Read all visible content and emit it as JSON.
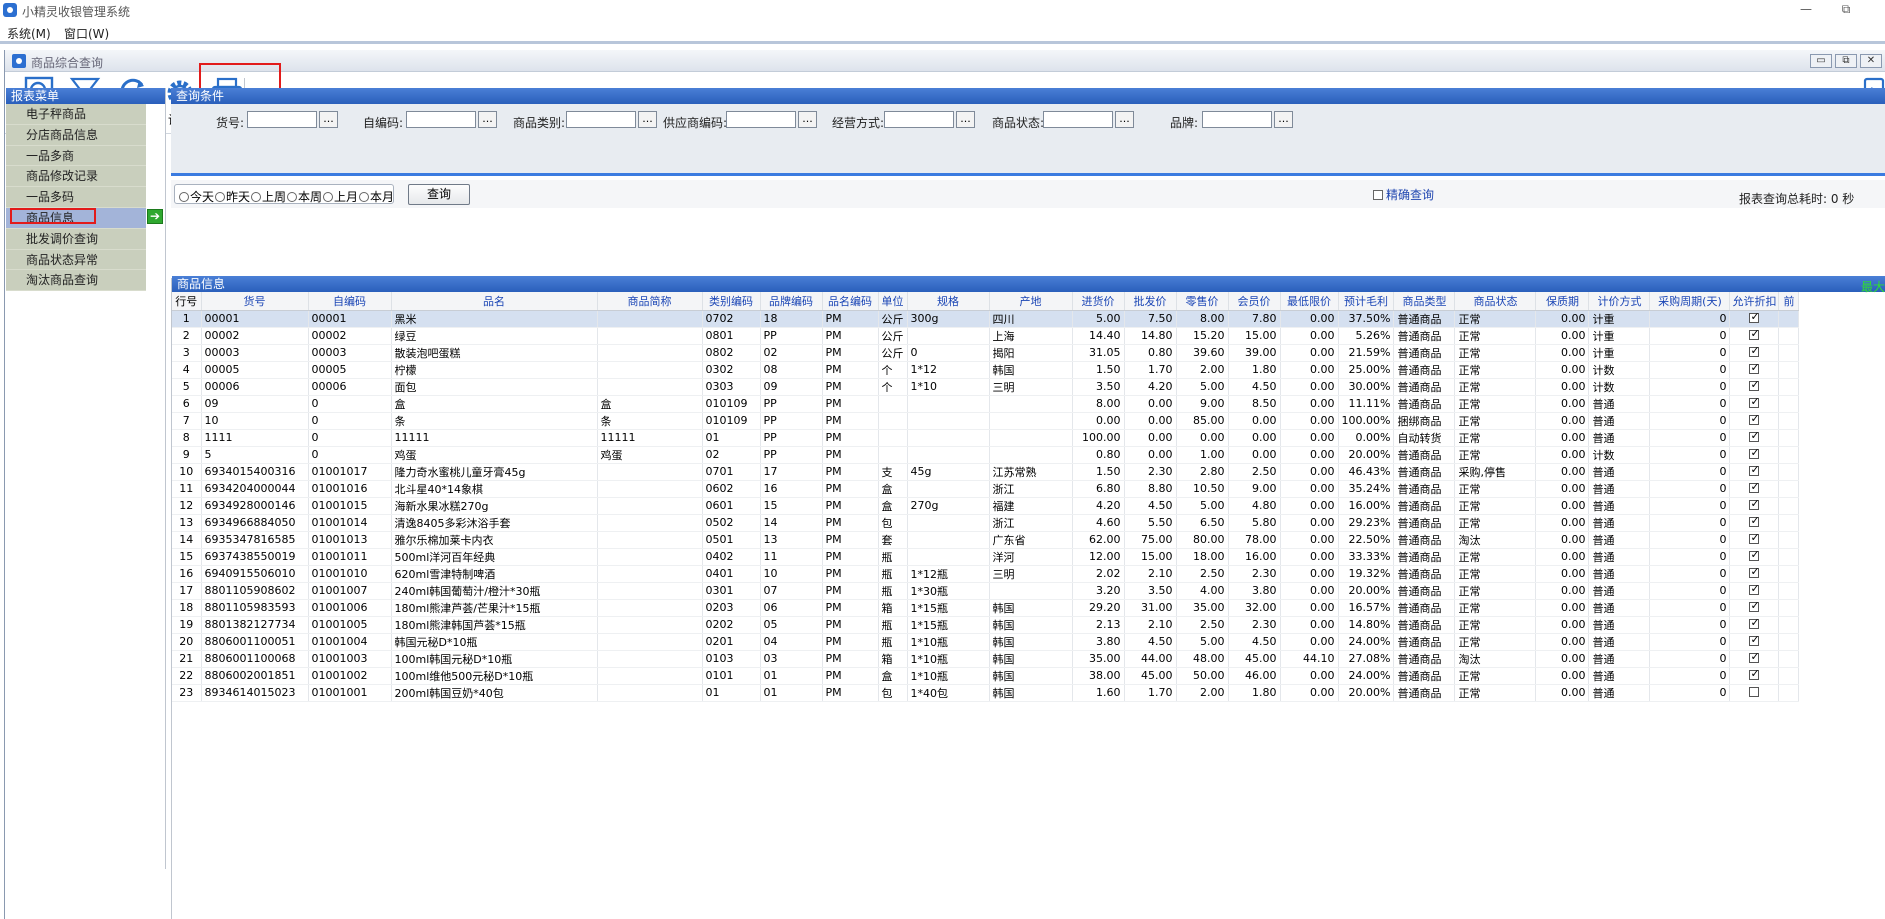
{
  "app": {
    "title": "小精灵收银管理系统",
    "min": "—",
    "restore": "⧉"
  },
  "menubar": {
    "system": "系统(M)",
    "window": "窗口(W)"
  },
  "child": {
    "title": "商品综合查询",
    "min": "▭",
    "restore": "⧉",
    "close": "✕"
  },
  "toolbar": {
    "query": "查询",
    "filter": "过滤",
    "sort": "排序",
    "settings": "设置",
    "print": "打印",
    "exit": "退出"
  },
  "left": {
    "header": "报表菜单",
    "items": [
      "电子秤商品",
      "分店商品信息",
      "一品多商",
      "商品修改记录",
      "一品多码",
      "商品信息",
      "批发调价查询",
      "商品状态异常",
      "淘汰商品查询"
    ],
    "selected_index": 5
  },
  "query": {
    "header": "查询条件",
    "labels": [
      "货号:",
      "自编码:",
      "商品类别:",
      "供应商编码:",
      "经营方式:",
      "商品状态:",
      "品牌:"
    ],
    "dots": "..."
  },
  "dates": {
    "options": [
      "今天",
      "昨天",
      "上周",
      "本周",
      "上月",
      "本月"
    ],
    "query_button": "查询",
    "exact": "精确查询",
    "elapsed": "报表查询总耗时: 0 秒"
  },
  "grid": {
    "header": "商品信息",
    "max_label": "最大",
    "columns": [
      "行号",
      "货号",
      "自编码",
      "品名",
      "商品简称",
      "类别编码",
      "品牌编码",
      "品名编码",
      "单位",
      "规格",
      "产地",
      "进货价",
      "批发价",
      "零售价",
      "会员价",
      "最低限价",
      "预计毛利",
      "商品类型",
      "商品状态",
      "保质期",
      "计价方式",
      "采购周期(天)",
      "允许折扣",
      "前"
    ],
    "rows": [
      [
        "1",
        "00001",
        "00001",
        "黑米",
        "",
        "0702",
        "18",
        "PM",
        "公斤",
        "300g",
        "四川",
        "5.00",
        "7.50",
        "8.00",
        "7.80",
        "0.00",
        "37.50%",
        "普通商品",
        "正常",
        "0.00",
        "计重",
        "0",
        true
      ],
      [
        "2",
        "00002",
        "00002",
        "绿豆",
        "",
        "0801",
        "PP",
        "PM",
        "公斤",
        "",
        "上海",
        "14.40",
        "14.80",
        "15.20",
        "15.00",
        "0.00",
        "5.26%",
        "普通商品",
        "正常",
        "0.00",
        "计重",
        "0",
        true
      ],
      [
        "3",
        "00003",
        "00003",
        "散装泡吧蛋糕",
        "",
        "0802",
        "02",
        "PM",
        "公斤",
        "0",
        "揭阳",
        "31.05",
        "0.80",
        "39.60",
        "39.00",
        "0.00",
        "21.59%",
        "普通商品",
        "正常",
        "0.00",
        "计重",
        "0",
        true
      ],
      [
        "4",
        "00005",
        "00005",
        "柠檬",
        "",
        "0302",
        "08",
        "PM",
        "个",
        "1*12",
        "韩国",
        "1.50",
        "1.70",
        "2.00",
        "1.80",
        "0.00",
        "25.00%",
        "普通商品",
        "正常",
        "0.00",
        "计数",
        "0",
        true
      ],
      [
        "5",
        "00006",
        "00006",
        "面包",
        "",
        "0303",
        "09",
        "PM",
        "个",
        "1*10",
        "三明",
        "3.50",
        "4.20",
        "5.00",
        "4.50",
        "0.00",
        "30.00%",
        "普通商品",
        "正常",
        "0.00",
        "计数",
        "0",
        true
      ],
      [
        "6",
        "09",
        "0",
        "盒",
        "盒",
        "010109",
        "PP",
        "PM",
        "",
        "",
        "",
        "8.00",
        "0.00",
        "9.00",
        "8.50",
        "0.00",
        "11.11%",
        "普通商品",
        "正常",
        "0.00",
        "普通",
        "0",
        true
      ],
      [
        "7",
        "10",
        "0",
        "条",
        "条",
        "010109",
        "PP",
        "PM",
        "",
        "",
        "",
        "0.00",
        "0.00",
        "85.00",
        "0.00",
        "0.00",
        "100.00%",
        "捆绑商品",
        "正常",
        "0.00",
        "普通",
        "0",
        true
      ],
      [
        "8",
        "1111",
        "0",
        "11111",
        "11111",
        "01",
        "PP",
        "PM",
        "",
        "",
        "",
        "100.00",
        "0.00",
        "0.00",
        "0.00",
        "0.00",
        "0.00%",
        "自动转货",
        "正常",
        "0.00",
        "普通",
        "0",
        true
      ],
      [
        "9",
        "5",
        "0",
        "鸡蛋",
        "鸡蛋",
        "02",
        "PP",
        "PM",
        "",
        "",
        "",
        "0.80",
        "0.00",
        "1.00",
        "0.00",
        "0.00",
        "20.00%",
        "普通商品",
        "正常",
        "0.00",
        "计数",
        "0",
        true
      ],
      [
        "10",
        "6934015400316",
        "01001017",
        "隆力奇水蜜桃儿童牙膏45g",
        "",
        "0701",
        "17",
        "PM",
        "支",
        "45g",
        "江苏常熟",
        "1.50",
        "2.30",
        "2.80",
        "2.50",
        "0.00",
        "46.43%",
        "普通商品",
        "采购,停售",
        "0.00",
        "普通",
        "0",
        true
      ],
      [
        "11",
        "6934204000044",
        "01001016",
        "北斗星40*14象棋",
        "",
        "0602",
        "16",
        "PM",
        "盒",
        "",
        "浙江",
        "6.80",
        "8.80",
        "10.50",
        "9.00",
        "0.00",
        "35.24%",
        "普通商品",
        "正常",
        "0.00",
        "普通",
        "0",
        true
      ],
      [
        "12",
        "6934928000146",
        "01001015",
        "海新水果冰糕270g",
        "",
        "0601",
        "15",
        "PM",
        "盒",
        "270g",
        "福建",
        "4.20",
        "4.50",
        "5.00",
        "4.80",
        "0.00",
        "16.00%",
        "普通商品",
        "正常",
        "0.00",
        "普通",
        "0",
        true
      ],
      [
        "13",
        "6934966884050",
        "01001014",
        "清逸8405多彩沐浴手套",
        "",
        "0502",
        "14",
        "PM",
        "包",
        "",
        "浙江",
        "4.60",
        "5.50",
        "6.50",
        "5.80",
        "0.00",
        "29.23%",
        "普通商品",
        "正常",
        "0.00",
        "普通",
        "0",
        true
      ],
      [
        "14",
        "6935347816585",
        "01001013",
        "雅尔乐棉加莱卡内衣",
        "",
        "0501",
        "13",
        "PM",
        "套",
        "",
        "广东省",
        "62.00",
        "75.00",
        "80.00",
        "78.00",
        "0.00",
        "22.50%",
        "普通商品",
        "淘汰",
        "0.00",
        "普通",
        "0",
        true
      ],
      [
        "15",
        "6937438550019",
        "01001011",
        "500ml洋河百年经典",
        "",
        "0402",
        "11",
        "PM",
        "瓶",
        "",
        "洋河",
        "12.00",
        "15.00",
        "18.00",
        "16.00",
        "0.00",
        "33.33%",
        "普通商品",
        "正常",
        "0.00",
        "普通",
        "0",
        true
      ],
      [
        "16",
        "6940915506010",
        "01001010",
        "620ml雪津特制啤酒",
        "",
        "0401",
        "10",
        "PM",
        "瓶",
        "1*12瓶",
        "三明",
        "2.02",
        "2.10",
        "2.50",
        "2.30",
        "0.00",
        "19.32%",
        "普通商品",
        "正常",
        "0.00",
        "普通",
        "0",
        true
      ],
      [
        "17",
        "8801105908602",
        "01001007",
        "240ml韩国葡萄汁/橙汁*30瓶",
        "",
        "0301",
        "07",
        "PM",
        "瓶",
        "1*30瓶",
        "",
        "3.20",
        "3.50",
        "4.00",
        "3.80",
        "0.00",
        "20.00%",
        "普通商品",
        "正常",
        "0.00",
        "普通",
        "0",
        true
      ],
      [
        "18",
        "8801105983593",
        "01001006",
        "180ml熊津芦荟/芒果汁*15瓶",
        "",
        "0203",
        "06",
        "PM",
        "箱",
        "1*15瓶",
        "韩国",
        "29.20",
        "31.00",
        "35.00",
        "32.00",
        "0.00",
        "16.57%",
        "普通商品",
        "正常",
        "0.00",
        "普通",
        "0",
        true
      ],
      [
        "19",
        "8801382127734",
        "01001005",
        "180ml熊津韩国芦荟*15瓶",
        "",
        "0202",
        "05",
        "PM",
        "瓶",
        "1*15瓶",
        "韩国",
        "2.13",
        "2.10",
        "2.50",
        "2.30",
        "0.00",
        "14.80%",
        "普通商品",
        "正常",
        "0.00",
        "普通",
        "0",
        true
      ],
      [
        "20",
        "8806001100051",
        "01001004",
        "韩国元秘D*10瓶",
        "",
        "0201",
        "04",
        "PM",
        "瓶",
        "1*10瓶",
        "韩国",
        "3.80",
        "4.50",
        "5.00",
        "4.50",
        "0.00",
        "24.00%",
        "普通商品",
        "正常",
        "0.00",
        "普通",
        "0",
        true
      ],
      [
        "21",
        "8806001100068",
        "01001003",
        "100ml韩国元秘D*10瓶",
        "",
        "0103",
        "03",
        "PM",
        "箱",
        "1*10瓶",
        "韩国",
        "35.00",
        "44.00",
        "48.00",
        "45.00",
        "44.10",
        "27.08%",
        "普通商品",
        "淘汰",
        "0.00",
        "普通",
        "0",
        true
      ],
      [
        "22",
        "8806002001851",
        "01001002",
        "100ml维他500元秘D*10瓶",
        "",
        "0101",
        "01",
        "PM",
        "盒",
        "1*10瓶",
        "韩国",
        "38.00",
        "45.00",
        "50.00",
        "46.00",
        "0.00",
        "24.00%",
        "普通商品",
        "正常",
        "0.00",
        "普通",
        "0",
        true
      ],
      [
        "23",
        "8934614015023",
        "01001001",
        "200ml韩国豆奶*40包",
        "",
        "01",
        "01",
        "PM",
        "包",
        "1*40包",
        "韩国",
        "1.60",
        "1.70",
        "2.00",
        "1.80",
        "0.00",
        "20.00%",
        "普通商品",
        "正常",
        "0.00",
        "普通",
        "0",
        false
      ]
    ]
  },
  "colors": {
    "header_blue": "#2a5fbb",
    "highlight_red": "#e21b1b",
    "menu_bg": "#c9cfbd",
    "selected_row": "#d5e0f0"
  }
}
